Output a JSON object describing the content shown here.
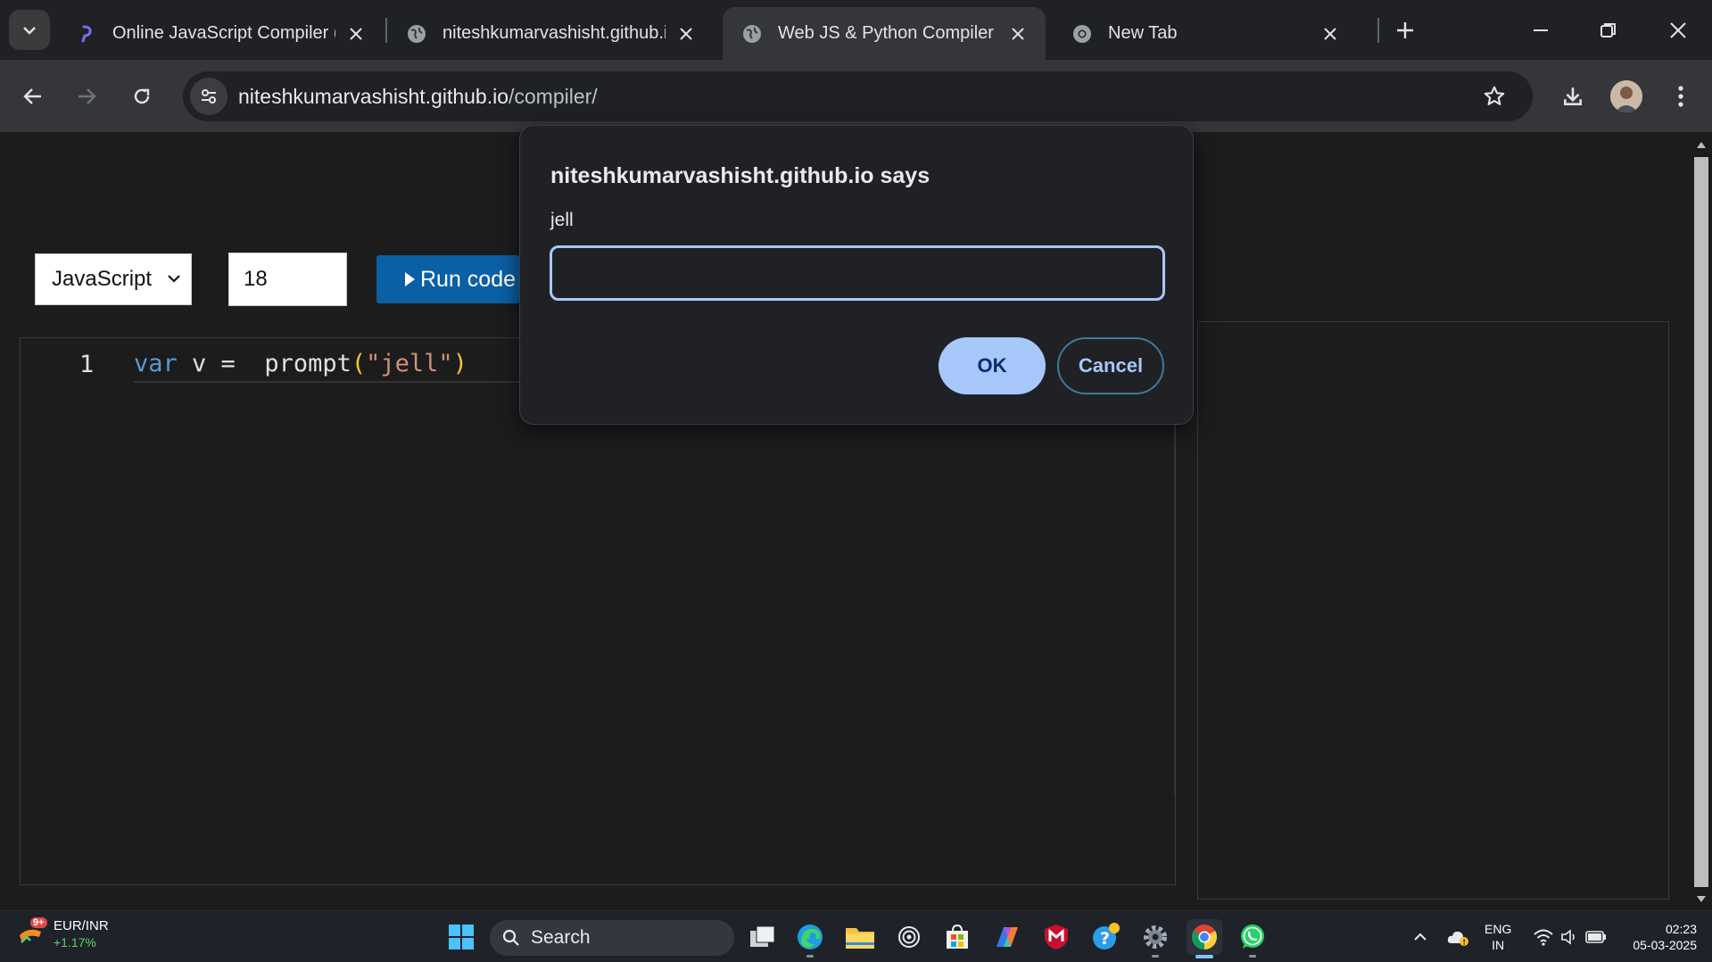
{
  "browser": {
    "tabs": [
      {
        "title": "Online JavaScript Compiler (",
        "active": false
      },
      {
        "title": "niteshkumarvashisht.github.io",
        "active": false
      },
      {
        "title": "Web JS & Python Compiler",
        "active": true
      },
      {
        "title": "New Tab",
        "active": false
      }
    ],
    "url_host": "niteshkumarvashisht.github.io",
    "url_path": "/compiler/"
  },
  "page": {
    "language_select": "JavaScript",
    "font_size_value": "18",
    "run_button_label": "Run code",
    "editor": {
      "line_number": "1",
      "code_tokens": {
        "keyword": "var",
        "ident": " v = ",
        "func": " prompt",
        "open_paren": "(",
        "string": "\"jell\"",
        "close_paren": ")"
      }
    }
  },
  "dialog": {
    "title": "niteshkumarvashisht.github.io says",
    "message": "jell",
    "input_value": "",
    "ok_label": "OK",
    "cancel_label": "Cancel"
  },
  "taskbar": {
    "widget_badge": "9+",
    "widget_title": "EUR/INR",
    "widget_change": "+1.17%",
    "search_label": "Search",
    "lang_line1": "ENG",
    "lang_line2": "IN",
    "time": "02:23",
    "date": "05-03-2025"
  }
}
